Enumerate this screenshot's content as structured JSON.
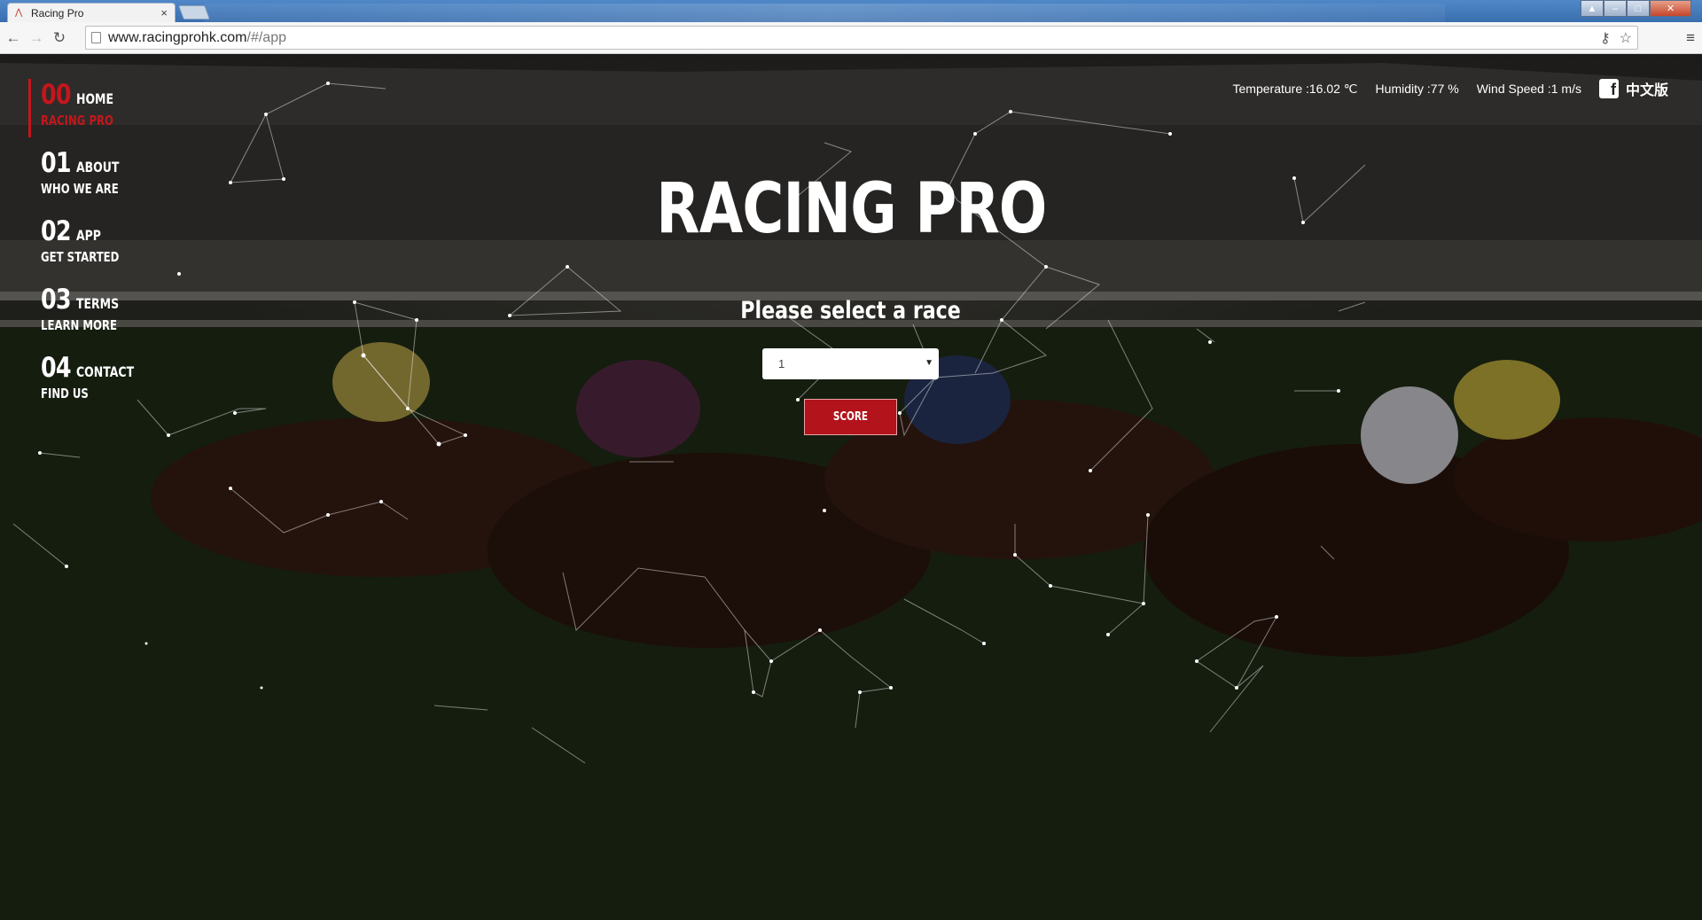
{
  "browser": {
    "tab_title": "Racing Pro",
    "tab_close": "×",
    "url_host": "www.racingprohk.com",
    "url_path": "/#/app",
    "back_icon": "←",
    "forward_icon": "→",
    "reload_icon": "↻",
    "key_icon": "⚷",
    "star_icon": "☆",
    "menu_icon": "≡",
    "win_minimize": "–",
    "win_maximize": "□",
    "win_close": "✕",
    "win_user": "▲"
  },
  "nav": [
    {
      "num": "00",
      "label": "HOME",
      "sub": "RACING PRO",
      "active": true
    },
    {
      "num": "01",
      "label": "ABOUT",
      "sub": "WHO WE ARE",
      "active": false
    },
    {
      "num": "02",
      "label": "APP",
      "sub": "GET STARTED",
      "active": false
    },
    {
      "num": "03",
      "label": "TERMS",
      "sub": "LEARN MORE",
      "active": false
    },
    {
      "num": "04",
      "label": "CONTACT",
      "sub": "FIND US",
      "active": false
    }
  ],
  "weather": {
    "temperature": "Temperature :16.02 ℃",
    "humidity": "Humidity :77 %",
    "wind": "Wind Speed :1 m/s"
  },
  "social": {
    "facebook_glyph": "f"
  },
  "lang_switch": "中文版",
  "hero": {
    "title": "RACING PRO",
    "prompt": "Please select a race"
  },
  "race_select": {
    "value": "1",
    "caret": "▼"
  },
  "score_button": "SCORE",
  "colors": {
    "accent": "#c4161c",
    "button": "#b3131b"
  }
}
